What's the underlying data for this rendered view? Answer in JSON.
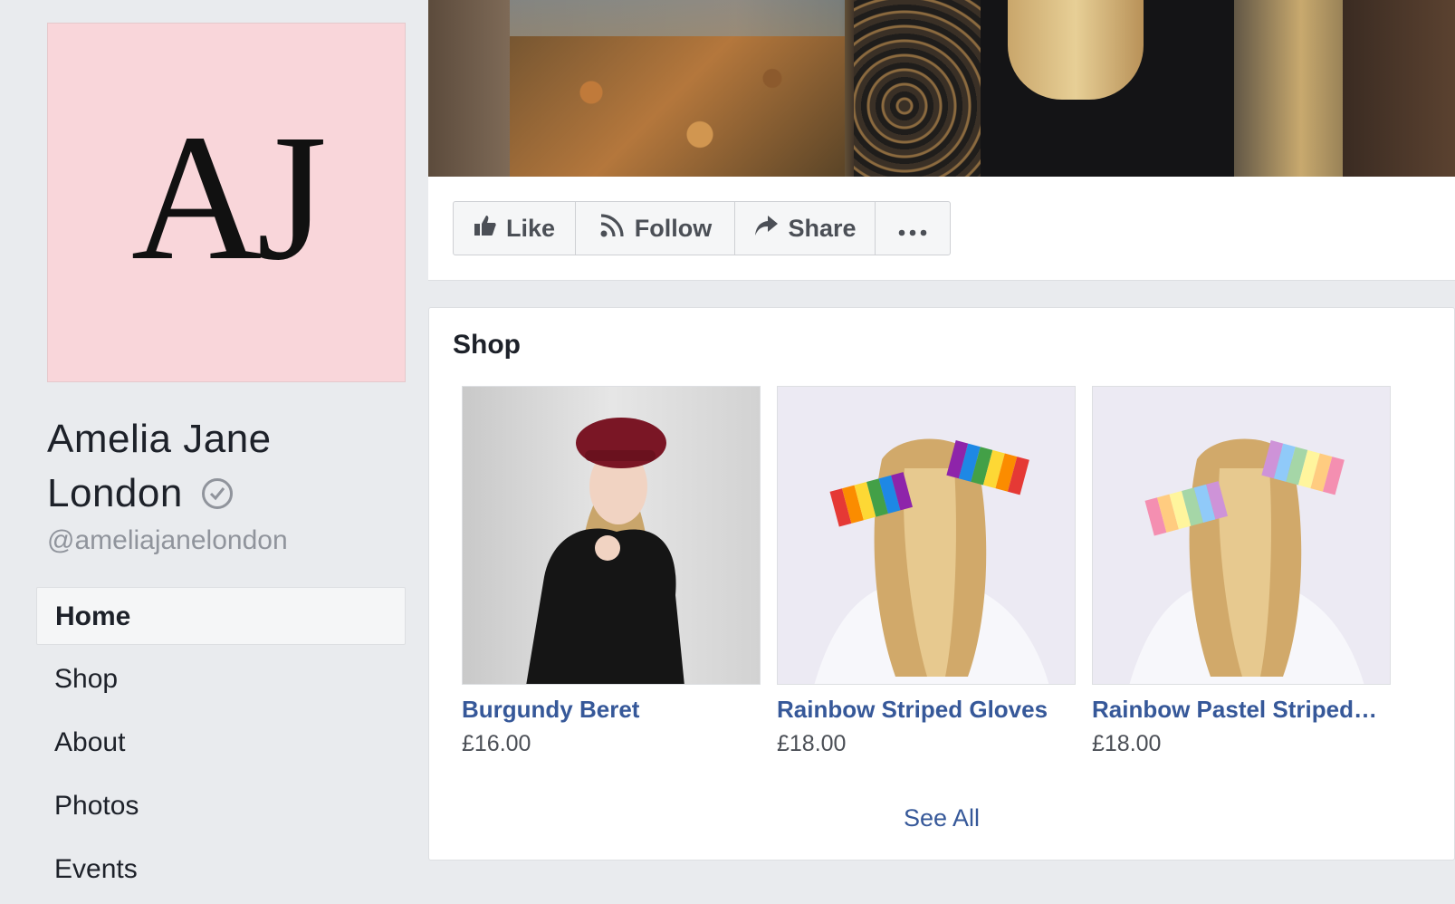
{
  "page": {
    "monogram": "AJ",
    "name": "Amelia Jane London",
    "name_line1": "Amelia Jane",
    "name_line2": "London",
    "handle": "@ameliajanelondon"
  },
  "nav": {
    "items": [
      {
        "label": "Home",
        "active": true
      },
      {
        "label": "Shop"
      },
      {
        "label": "About"
      },
      {
        "label": "Photos"
      },
      {
        "label": "Events"
      }
    ]
  },
  "actions": {
    "like": "Like",
    "follow": "Follow",
    "share": "Share",
    "more_icon": "more-dots-icon"
  },
  "shop": {
    "title": "Shop",
    "products": [
      {
        "name": "Burgundy Beret",
        "price": "£16.00"
      },
      {
        "name": "Rainbow Striped Gloves",
        "price": "£18.00"
      },
      {
        "name": "Rainbow Pastel Striped…",
        "price": "£18.00"
      }
    ],
    "see_all": "See All"
  },
  "colors": {
    "background": "#e9ebee",
    "link": "#365899",
    "profile_bg": "#f9d6da"
  }
}
